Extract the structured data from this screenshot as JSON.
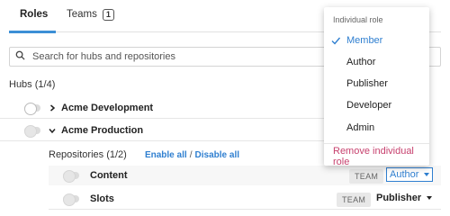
{
  "tabs": {
    "roles_label": "Roles",
    "teams_label": "Teams",
    "teams_count": "1"
  },
  "search": {
    "placeholder": "Search for hubs and repositories"
  },
  "hubs": {
    "heading": "Hubs (1/4)",
    "items": [
      {
        "name": "Acme Development",
        "expanded": false
      },
      {
        "name": "Acme Production",
        "expanded": true
      }
    ]
  },
  "repositories": {
    "heading": "Repositories (1/2)",
    "enable_all": "Enable all",
    "separator": "/",
    "disable_all": "Disable all",
    "items": [
      {
        "name": "Content",
        "tag": "TEAM",
        "role": "Author"
      },
      {
        "name": "Slots",
        "tag": "TEAM",
        "role": "Publisher"
      }
    ]
  },
  "role_menu": {
    "header": "Individual role",
    "options": [
      "Member",
      "Author",
      "Publisher",
      "Developer",
      "Admin"
    ],
    "selected": "Member",
    "remove_label": "Remove individual role"
  },
  "colors": {
    "accent": "#2f7fd0",
    "danger": "#c7416e"
  }
}
